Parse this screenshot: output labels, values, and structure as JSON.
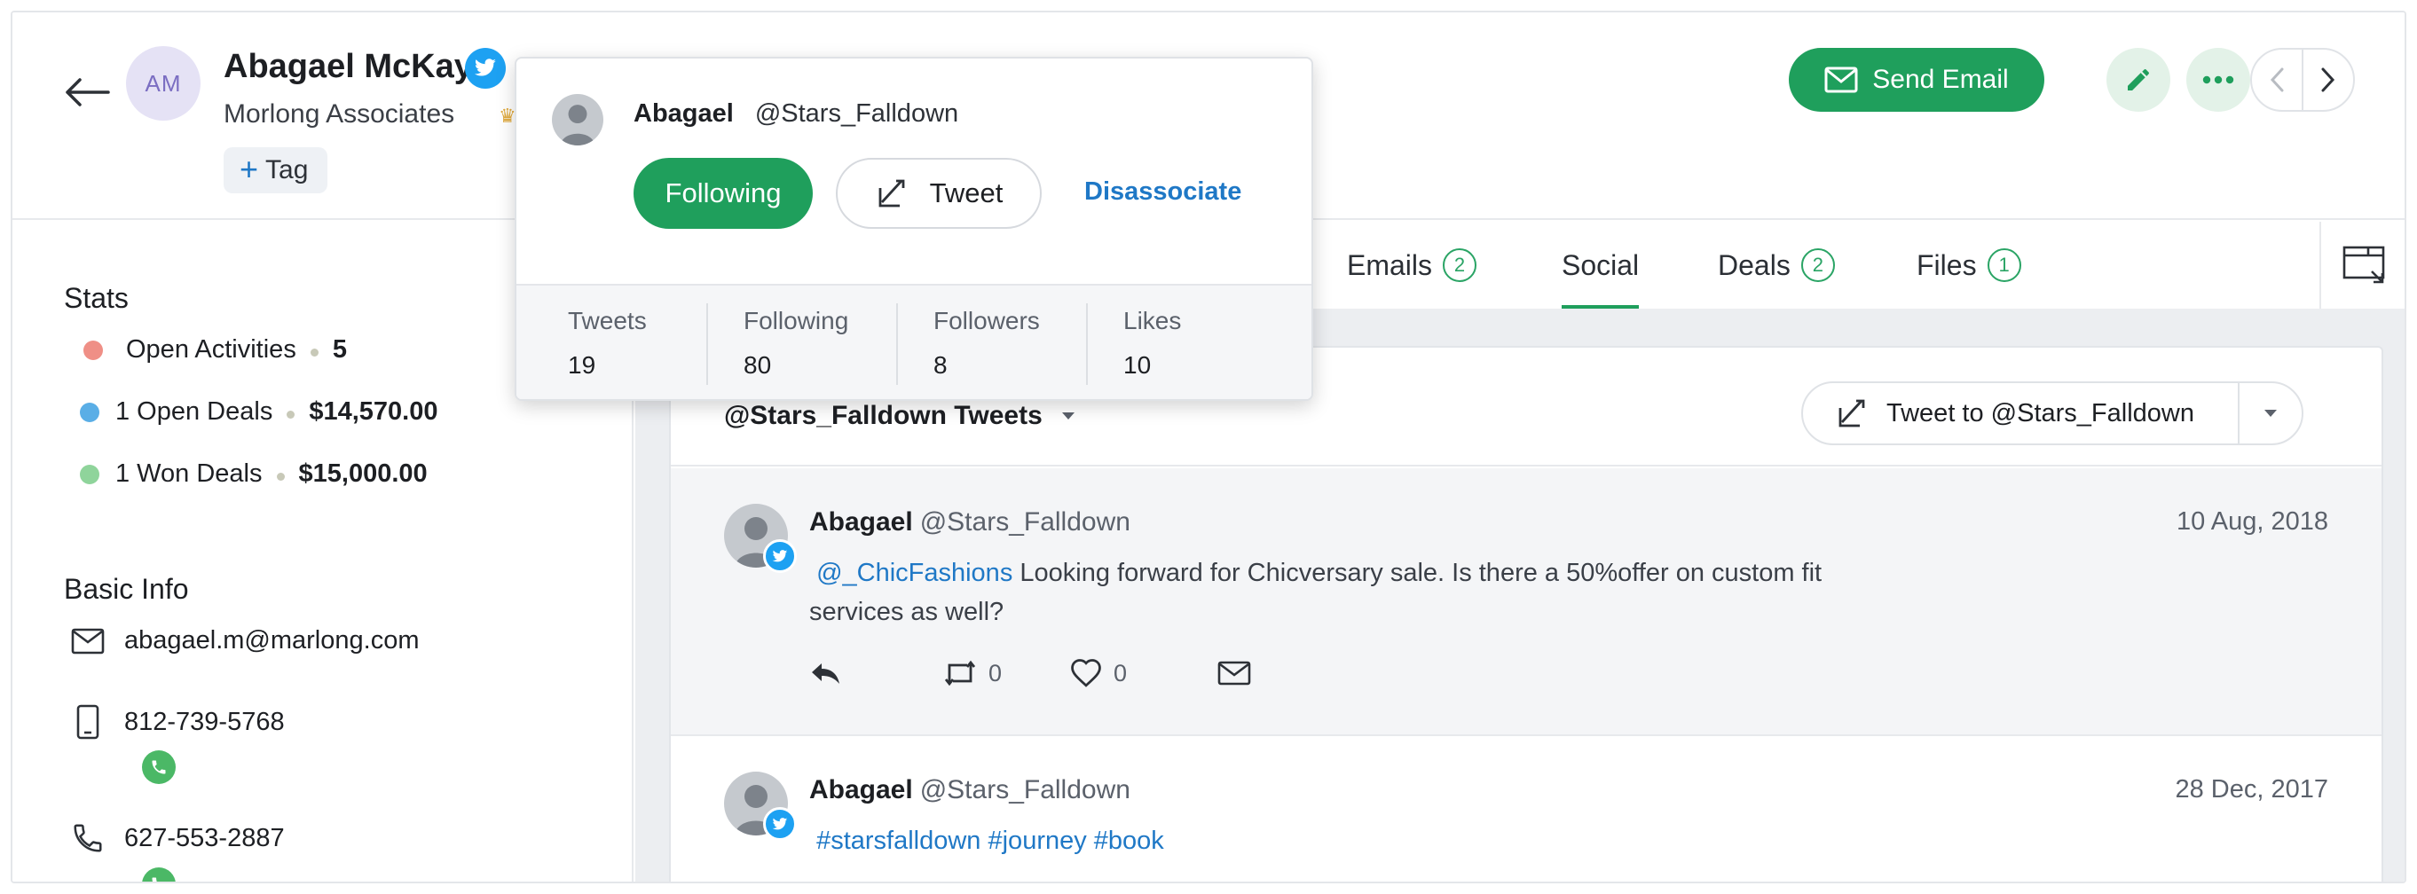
{
  "header": {
    "avatar_initials": "AM",
    "contact_name": "Abagael McKay",
    "company": "Morlong Associates",
    "tag_label": "Tag",
    "send_email_label": "Send Email"
  },
  "stats": {
    "title": "Stats",
    "items": [
      {
        "label": "Open Activities",
        "value": "5",
        "color": "#ef8f86"
      },
      {
        "label": "1 Open Deals",
        "value": "$14,570.00",
        "color": "#5aaee6"
      },
      {
        "label": "1 Won Deals",
        "value": "$15,000.00",
        "color": "#8fd49b"
      }
    ]
  },
  "basic_info": {
    "title": "Basic Info",
    "email": "abagael.m@marlong.com",
    "phone": "812-739-5768",
    "mobile": "627-553-2887"
  },
  "tabs": [
    {
      "label": "Emails",
      "count": "2"
    },
    {
      "label": "Social",
      "count": ""
    },
    {
      "label": "Deals",
      "count": "2"
    },
    {
      "label": "Files",
      "count": "1"
    }
  ],
  "feed": {
    "title": "@Stars_Falldown Tweets",
    "tweet_to_label": "Tweet to @Stars_Falldown",
    "tweets": [
      {
        "name": "Abagael",
        "handle": "@Stars_Falldown",
        "date": "10 Aug, 2018",
        "mention": "@_ChicFashions",
        "text": " Looking forward for Chicversary sale. Is there a 50%offer on custom fit services as well?",
        "retweets": "0",
        "likes": "0"
      },
      {
        "name": "Abagael",
        "handle": "@Stars_Falldown",
        "date": "28 Dec, 2017",
        "text": "#starsfalldown #journey #book"
      }
    ]
  },
  "popover": {
    "name": "Abagael",
    "handle": "@Stars_Falldown",
    "following_label": "Following",
    "tweet_label": "Tweet",
    "disassociate_label": "Disassociate",
    "stats": [
      {
        "label": "Tweets",
        "value": "19"
      },
      {
        "label": "Following",
        "value": "80"
      },
      {
        "label": "Followers",
        "value": "8"
      },
      {
        "label": "Likes",
        "value": "10"
      }
    ]
  },
  "colors": {
    "accent_green": "#1f9f5c",
    "twitter_blue": "#1da1f2",
    "link_blue": "#1f78c6"
  }
}
